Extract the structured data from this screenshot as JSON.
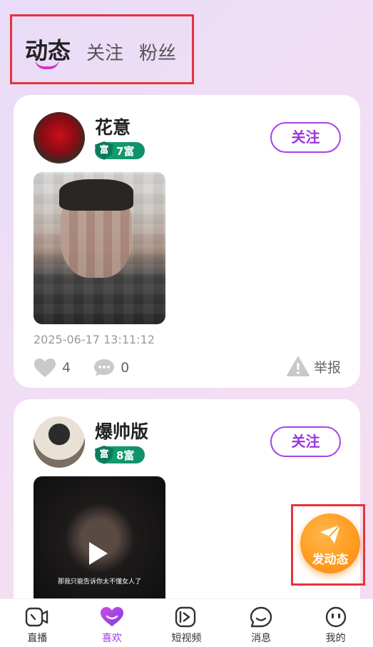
{
  "tabs": [
    {
      "label": "动态",
      "active": true
    },
    {
      "label": "关注",
      "active": false
    },
    {
      "label": "粉丝",
      "active": false
    }
  ],
  "posts": [
    {
      "user": "花意",
      "rich_level": "7富",
      "rich_badge_char": "富",
      "follow_label": "关注",
      "media": "photo",
      "timestamp": "2025-06-17 13:11:12",
      "likes": "4",
      "comments": "0",
      "report_label": "举报"
    },
    {
      "user": "爆帅版",
      "rich_level": "8富",
      "rich_badge_char": "富",
      "follow_label": "关注",
      "media": "video",
      "video_subtitle": "那我只能告诉你太不懂女人了"
    }
  ],
  "publish": {
    "label": "发动态",
    "icon": "send-icon"
  },
  "bottom_nav": [
    {
      "label": "直播",
      "icon": "live-icon",
      "active": false
    },
    {
      "label": "喜欢",
      "icon": "heart-icon",
      "active": true
    },
    {
      "label": "短视频",
      "icon": "short-video-icon",
      "active": false
    },
    {
      "label": "消息",
      "icon": "message-icon",
      "active": false
    },
    {
      "label": "我的",
      "icon": "profile-icon",
      "active": false
    }
  ],
  "colors": {
    "accent": "#a23be6",
    "publish": "#ff9c21",
    "badge": "#17a36e"
  }
}
